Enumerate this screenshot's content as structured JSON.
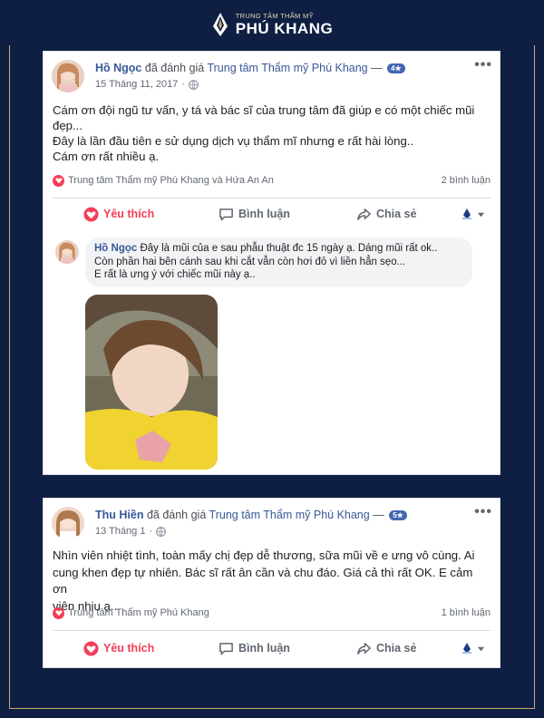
{
  "brand": {
    "small": "TRUNG TÂM THẨM MỸ",
    "big": "PHÚ KHANG"
  },
  "colors": {
    "background": "#0f1f44",
    "gold": "#c8a86a",
    "link": "#385898",
    "like": "#f33e58",
    "badge": "#4267b2"
  },
  "posts": [
    {
      "author": "Hồ Ngọc",
      "verb": "đã đánh giá",
      "page": "Trung tâm Thẩm mỹ Phú Khang",
      "dash": "—",
      "rating": "4★",
      "date": "15 Tháng 11, 2017",
      "dot": "·",
      "privacy_icon": "globe-icon",
      "more": "•••",
      "text": [
        "Cám ơn đội ngũ tư vấn, y tá và bác sĩ của trung tâm đã giúp e có một chiếc mũi",
        "đẹp...",
        "Đây là lần đầu tiên e sử dụng dịch vụ thẩm mĩ nhưng e rất hài lòng..",
        "Cám ơn rất nhiều ạ."
      ],
      "reactors": "Trung tâm Thẩm mỹ Phú Khang và Hứa An An",
      "comments_count": "2 bình luận",
      "actions": {
        "like": "Yêu thích",
        "comment": "Bình luận",
        "share": "Chia sẻ"
      },
      "comment": {
        "author": "Hồ Ngọc",
        "lines": [
          "Đây là mũi của e sau phẫu thuật đc 15 ngày ạ. Dáng mũi rất ok..",
          "Còn phần hai bên cánh sau khi cắt vẫn còn hơi đỏ vì liền hẳn sẹo...",
          "E rất là ưng ý với chiếc mũi này ạ.."
        ]
      }
    },
    {
      "author": "Thu Hiền",
      "verb": "đã đánh giá",
      "page": "Trung tâm Thẩm mỹ Phú Khang",
      "dash": "—",
      "rating": "5★",
      "date": "13 Tháng 1",
      "dot": "·",
      "privacy_icon": "globe-icon",
      "more": "•••",
      "text": [
        "Nhìn viên nhiệt tình, toàn mấy chị đẹp dễ thương, sữa mũi về e ưng vô cùng. Ai",
        "cung khen đẹp tự nhiên. Bác sĩ rất ân cần và chu đáo. Giá cả thì rất OK. E cảm ơn",
        "viên nhiu ạ..."
      ],
      "reactors": "Trung tâm Thẩm mỹ Phú Khang",
      "comments_count": "1 bình luận",
      "actions": {
        "like": "Yêu thích",
        "comment": "Bình luận",
        "share": "Chia sẻ"
      }
    }
  ]
}
